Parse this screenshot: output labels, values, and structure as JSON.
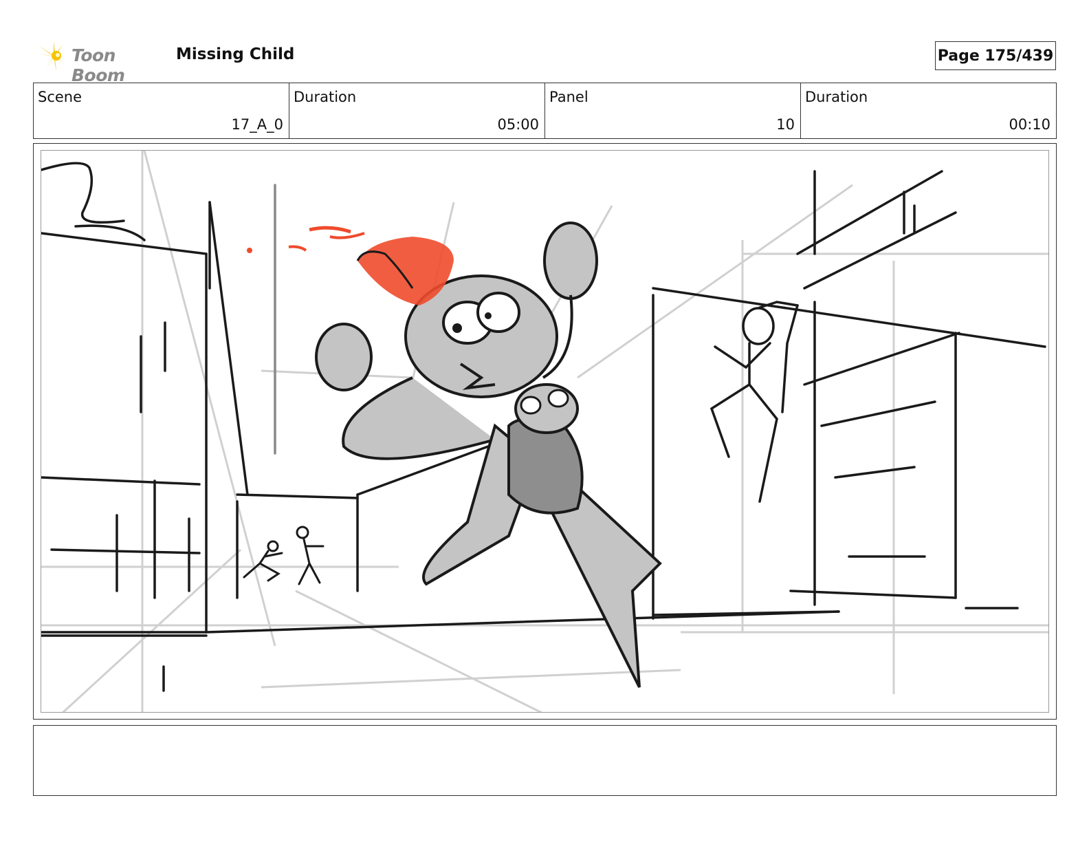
{
  "header": {
    "brand": "Toon Boom",
    "project_title": "Missing Child",
    "page_label": "Page 175/439"
  },
  "info": {
    "scene_label": "Scene",
    "scene_value": "17_A_0",
    "scene_duration_label": "Duration",
    "scene_duration_value": "05:00",
    "panel_label": "Panel",
    "panel_value": "10",
    "panel_duration_label": "Duration",
    "panel_duration_value": "00:10"
  },
  "notes": {
    "text": ""
  },
  "colors": {
    "accent_flame": "#ef4b2c",
    "logo_yellow": "#f5c400",
    "sketch_gray": "#c4c4c4",
    "ink": "#111111"
  }
}
